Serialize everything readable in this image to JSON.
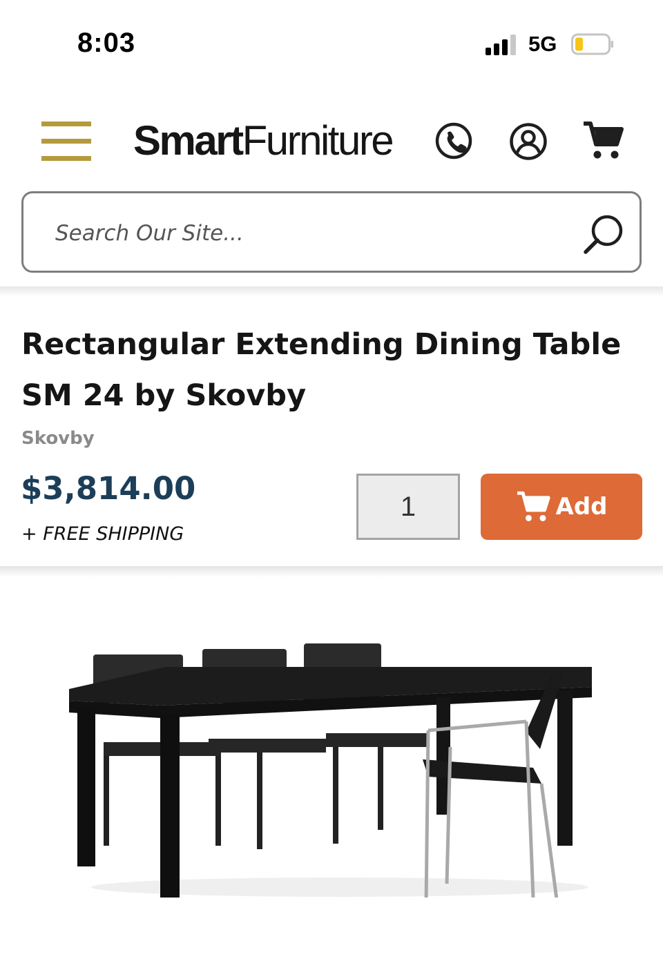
{
  "status_bar": {
    "time": "8:03",
    "network": "5G",
    "signal_bars": 3,
    "battery_level": 0.2,
    "battery_color": "#f5c518"
  },
  "header": {
    "logo_bold": "Smart",
    "logo_light": "Furniture",
    "menu_icon": "hamburger-icon",
    "menu_color": "#b59a3d",
    "icons": [
      "phone-icon",
      "account-icon",
      "cart-icon"
    ]
  },
  "search": {
    "placeholder": "Search Our Site...",
    "icon": "search-icon"
  },
  "product": {
    "title": "Rectangular Extending Dining Table SM 24 by Skovby",
    "brand": "Skovby",
    "price": "$3,814.00",
    "price_color": "#1d3e58",
    "shipping": "+ FREE SHIPPING",
    "quantity": "1",
    "add_label": "Add",
    "add_color": "#de6a37",
    "image_icon": "dining-table-photo"
  }
}
